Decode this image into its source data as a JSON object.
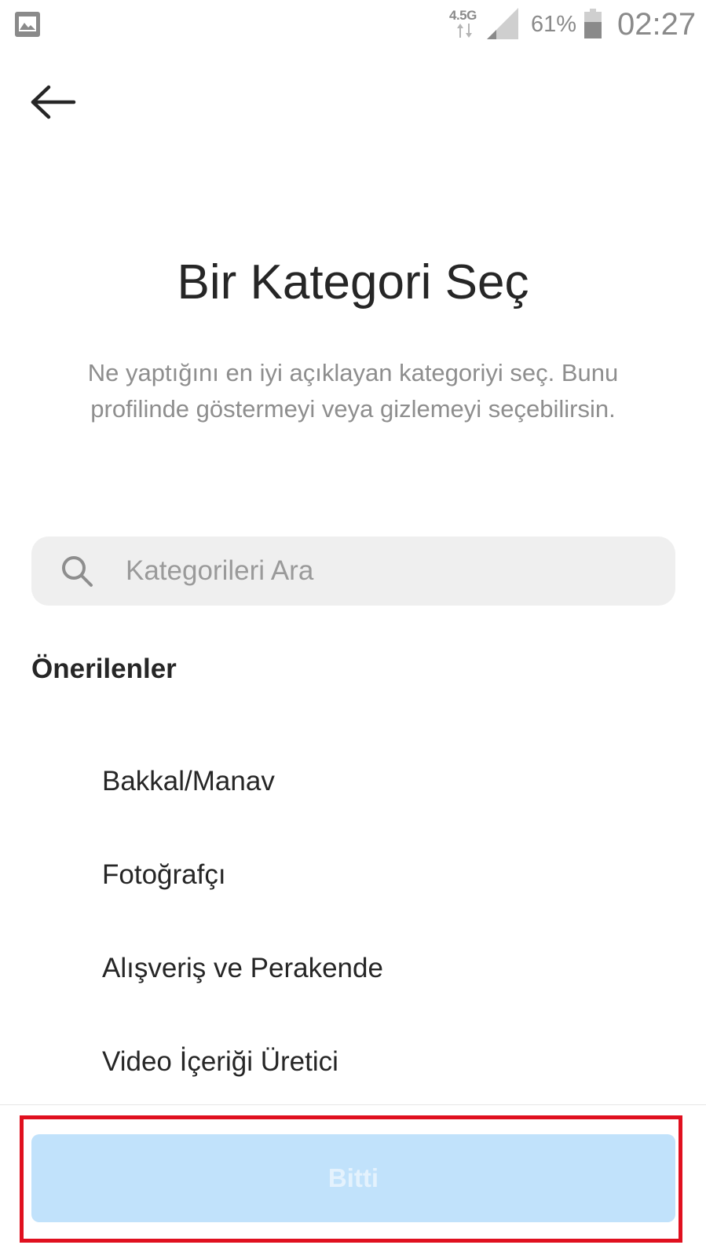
{
  "status_bar": {
    "network_type": "4.5G",
    "battery_percent": "61%",
    "time": "02:27",
    "icons": [
      "gallery-notification-icon",
      "data-transfer-arrows-icon",
      "signal-strength-icon",
      "battery-icon"
    ]
  },
  "header": {
    "back_icon": "arrow-left-icon"
  },
  "main": {
    "title": "Bir Kategori Seç",
    "subtitle": "Ne yaptığını en iyi açıklayan kategoriyi seç. Bunu profilinde göstermeyi veya gizlemeyi seçebilirsin.",
    "search": {
      "placeholder": "Kategorileri Ara",
      "value": "",
      "icon": "search-icon"
    },
    "suggestions_header": "Önerilenler",
    "categories": [
      {
        "label": "Bakkal/Manav"
      },
      {
        "label": "Fotoğrafçı"
      },
      {
        "label": "Alışveriş ve Perakende"
      },
      {
        "label": "Video İçeriği Üretici"
      }
    ]
  },
  "footer": {
    "done_label": "Bitti",
    "done_enabled": false
  },
  "colors": {
    "done_button_bg_disabled": "#c1e2fb",
    "highlight_outline": "#e0101f",
    "search_bg": "#efefef",
    "secondary_text": "#8e8e8e"
  }
}
